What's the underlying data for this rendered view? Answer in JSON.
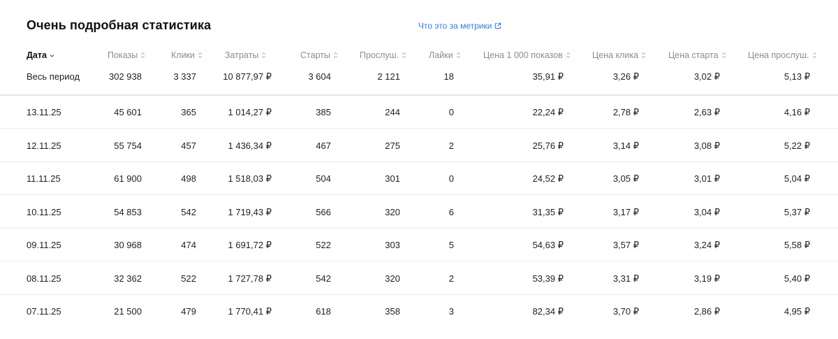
{
  "page": {
    "title": "Очень подробная статистика",
    "metrics_link": "Что это за метрики"
  },
  "table": {
    "headers": [
      "Дата",
      "Показы",
      "Клики",
      "Затраты",
      "Старты",
      "Прослуш.",
      "Лайки",
      "Цена 1 000 показов",
      "Цена клика",
      "Цена старта",
      "Цена прослуш."
    ],
    "total": [
      "Весь период",
      "302 938",
      "3 337",
      "10 877,97 ₽",
      "3 604",
      "2 121",
      "18",
      "35,91 ₽",
      "3,26 ₽",
      "3,02 ₽",
      "5,13 ₽"
    ],
    "rows": [
      [
        "13.11.25",
        "45 601",
        "365",
        "1 014,27 ₽",
        "385",
        "244",
        "0",
        "22,24 ₽",
        "2,78 ₽",
        "2,63 ₽",
        "4,16 ₽"
      ],
      [
        "12.11.25",
        "55 754",
        "457",
        "1 436,34 ₽",
        "467",
        "275",
        "2",
        "25,76 ₽",
        "3,14 ₽",
        "3,08 ₽",
        "5,22 ₽"
      ],
      [
        "11.11.25",
        "61 900",
        "498",
        "1 518,03 ₽",
        "504",
        "301",
        "0",
        "24,52 ₽",
        "3,05 ₽",
        "3,01 ₽",
        "5,04 ₽"
      ],
      [
        "10.11.25",
        "54 853",
        "542",
        "1 719,43 ₽",
        "566",
        "320",
        "6",
        "31,35 ₽",
        "3,17 ₽",
        "3,04 ₽",
        "5,37 ₽"
      ],
      [
        "09.11.25",
        "30 968",
        "474",
        "1 691,72 ₽",
        "522",
        "303",
        "5",
        "54,63 ₽",
        "3,57 ₽",
        "3,24 ₽",
        "5,58 ₽"
      ],
      [
        "08.11.25",
        "32 362",
        "522",
        "1 727,78 ₽",
        "542",
        "320",
        "2",
        "53,39 ₽",
        "3,31 ₽",
        "3,19 ₽",
        "5,40 ₽"
      ],
      [
        "07.11.25",
        "21 500",
        "479",
        "1 770,41 ₽",
        "618",
        "358",
        "3",
        "82,34 ₽",
        "3,70 ₽",
        "2,86 ₽",
        "4,95 ₽"
      ]
    ]
  },
  "icons": {
    "metrics_link": "external-link-icon",
    "sort": "sort-arrows-icon",
    "sort_active": "sort-down-icon"
  },
  "colors": {
    "link": "#2f7fd6",
    "header_text": "#8c8c8c",
    "divider": "#ececec"
  }
}
